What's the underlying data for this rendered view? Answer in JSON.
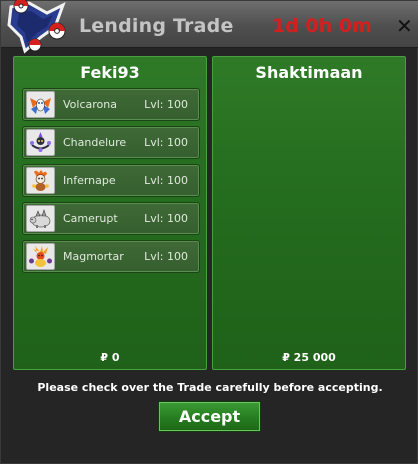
{
  "window": {
    "title": "Lending Trade",
    "timer": "1d 0h 0m",
    "close_glyph": "✕",
    "logo_icon": "pokeball-logo-icon"
  },
  "left_panel": {
    "player": "Feki93",
    "pokemon": [
      {
        "name": "Volcarona",
        "level": "Lvl: 100",
        "icon": "volcarona-icon"
      },
      {
        "name": "Chandelure",
        "level": "Lvl: 100",
        "icon": "chandelure-icon"
      },
      {
        "name": "Infernape",
        "level": "Lvl: 100",
        "icon": "infernape-icon"
      },
      {
        "name": "Camerupt",
        "level": "Lvl: 100",
        "icon": "camerupt-icon"
      },
      {
        "name": "Magmortar",
        "level": "Lvl: 100",
        "icon": "magmortar-icon"
      }
    ],
    "money": "₽ 0"
  },
  "right_panel": {
    "player": "Shaktimaan",
    "pokemon": [],
    "money": "₽ 25 000"
  },
  "notice": "Please check over the Trade carefully before accepting.",
  "accept_label": "Accept",
  "colors": {
    "panel_green": "#256d1f",
    "timer_red": "#d41f1f",
    "title_gray": "#c4c4c4"
  }
}
